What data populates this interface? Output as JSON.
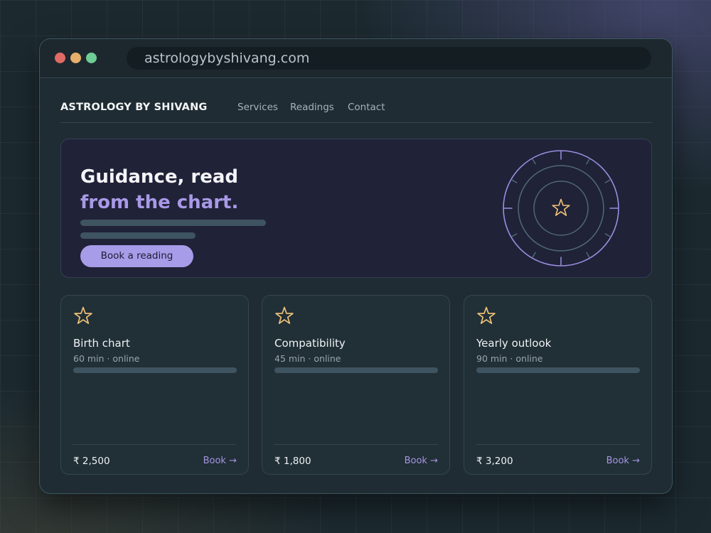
{
  "browser": {
    "url": "astrologybyshivang.com"
  },
  "nav": {
    "brand": "ASTROLOGY BY SHIVANG",
    "links": [
      "Services",
      "Readings",
      "Contact"
    ]
  },
  "hero": {
    "headline_line1": "Guidance, read",
    "headline_line2": "from the chart.",
    "cta_label": "Book a reading",
    "emblem_icon": "star-icon"
  },
  "services": [
    {
      "title": "Birth chart",
      "meta": "60 min · online",
      "price": "₹ 2,500",
      "book_label": "Book →",
      "icon": "star-icon"
    },
    {
      "title": "Compatibility",
      "meta": "45 min · online",
      "price": "₹ 1,800",
      "book_label": "Book →",
      "icon": "star-icon"
    },
    {
      "title": "Yearly outlook",
      "meta": "90 min · online",
      "price": "₹ 3,200",
      "book_label": "Book →",
      "icon": "star-icon"
    }
  ],
  "colors": {
    "accent": "#a79ce8",
    "star": "#f0c277",
    "background": "#1f2c33",
    "hero_background": "#202238"
  }
}
